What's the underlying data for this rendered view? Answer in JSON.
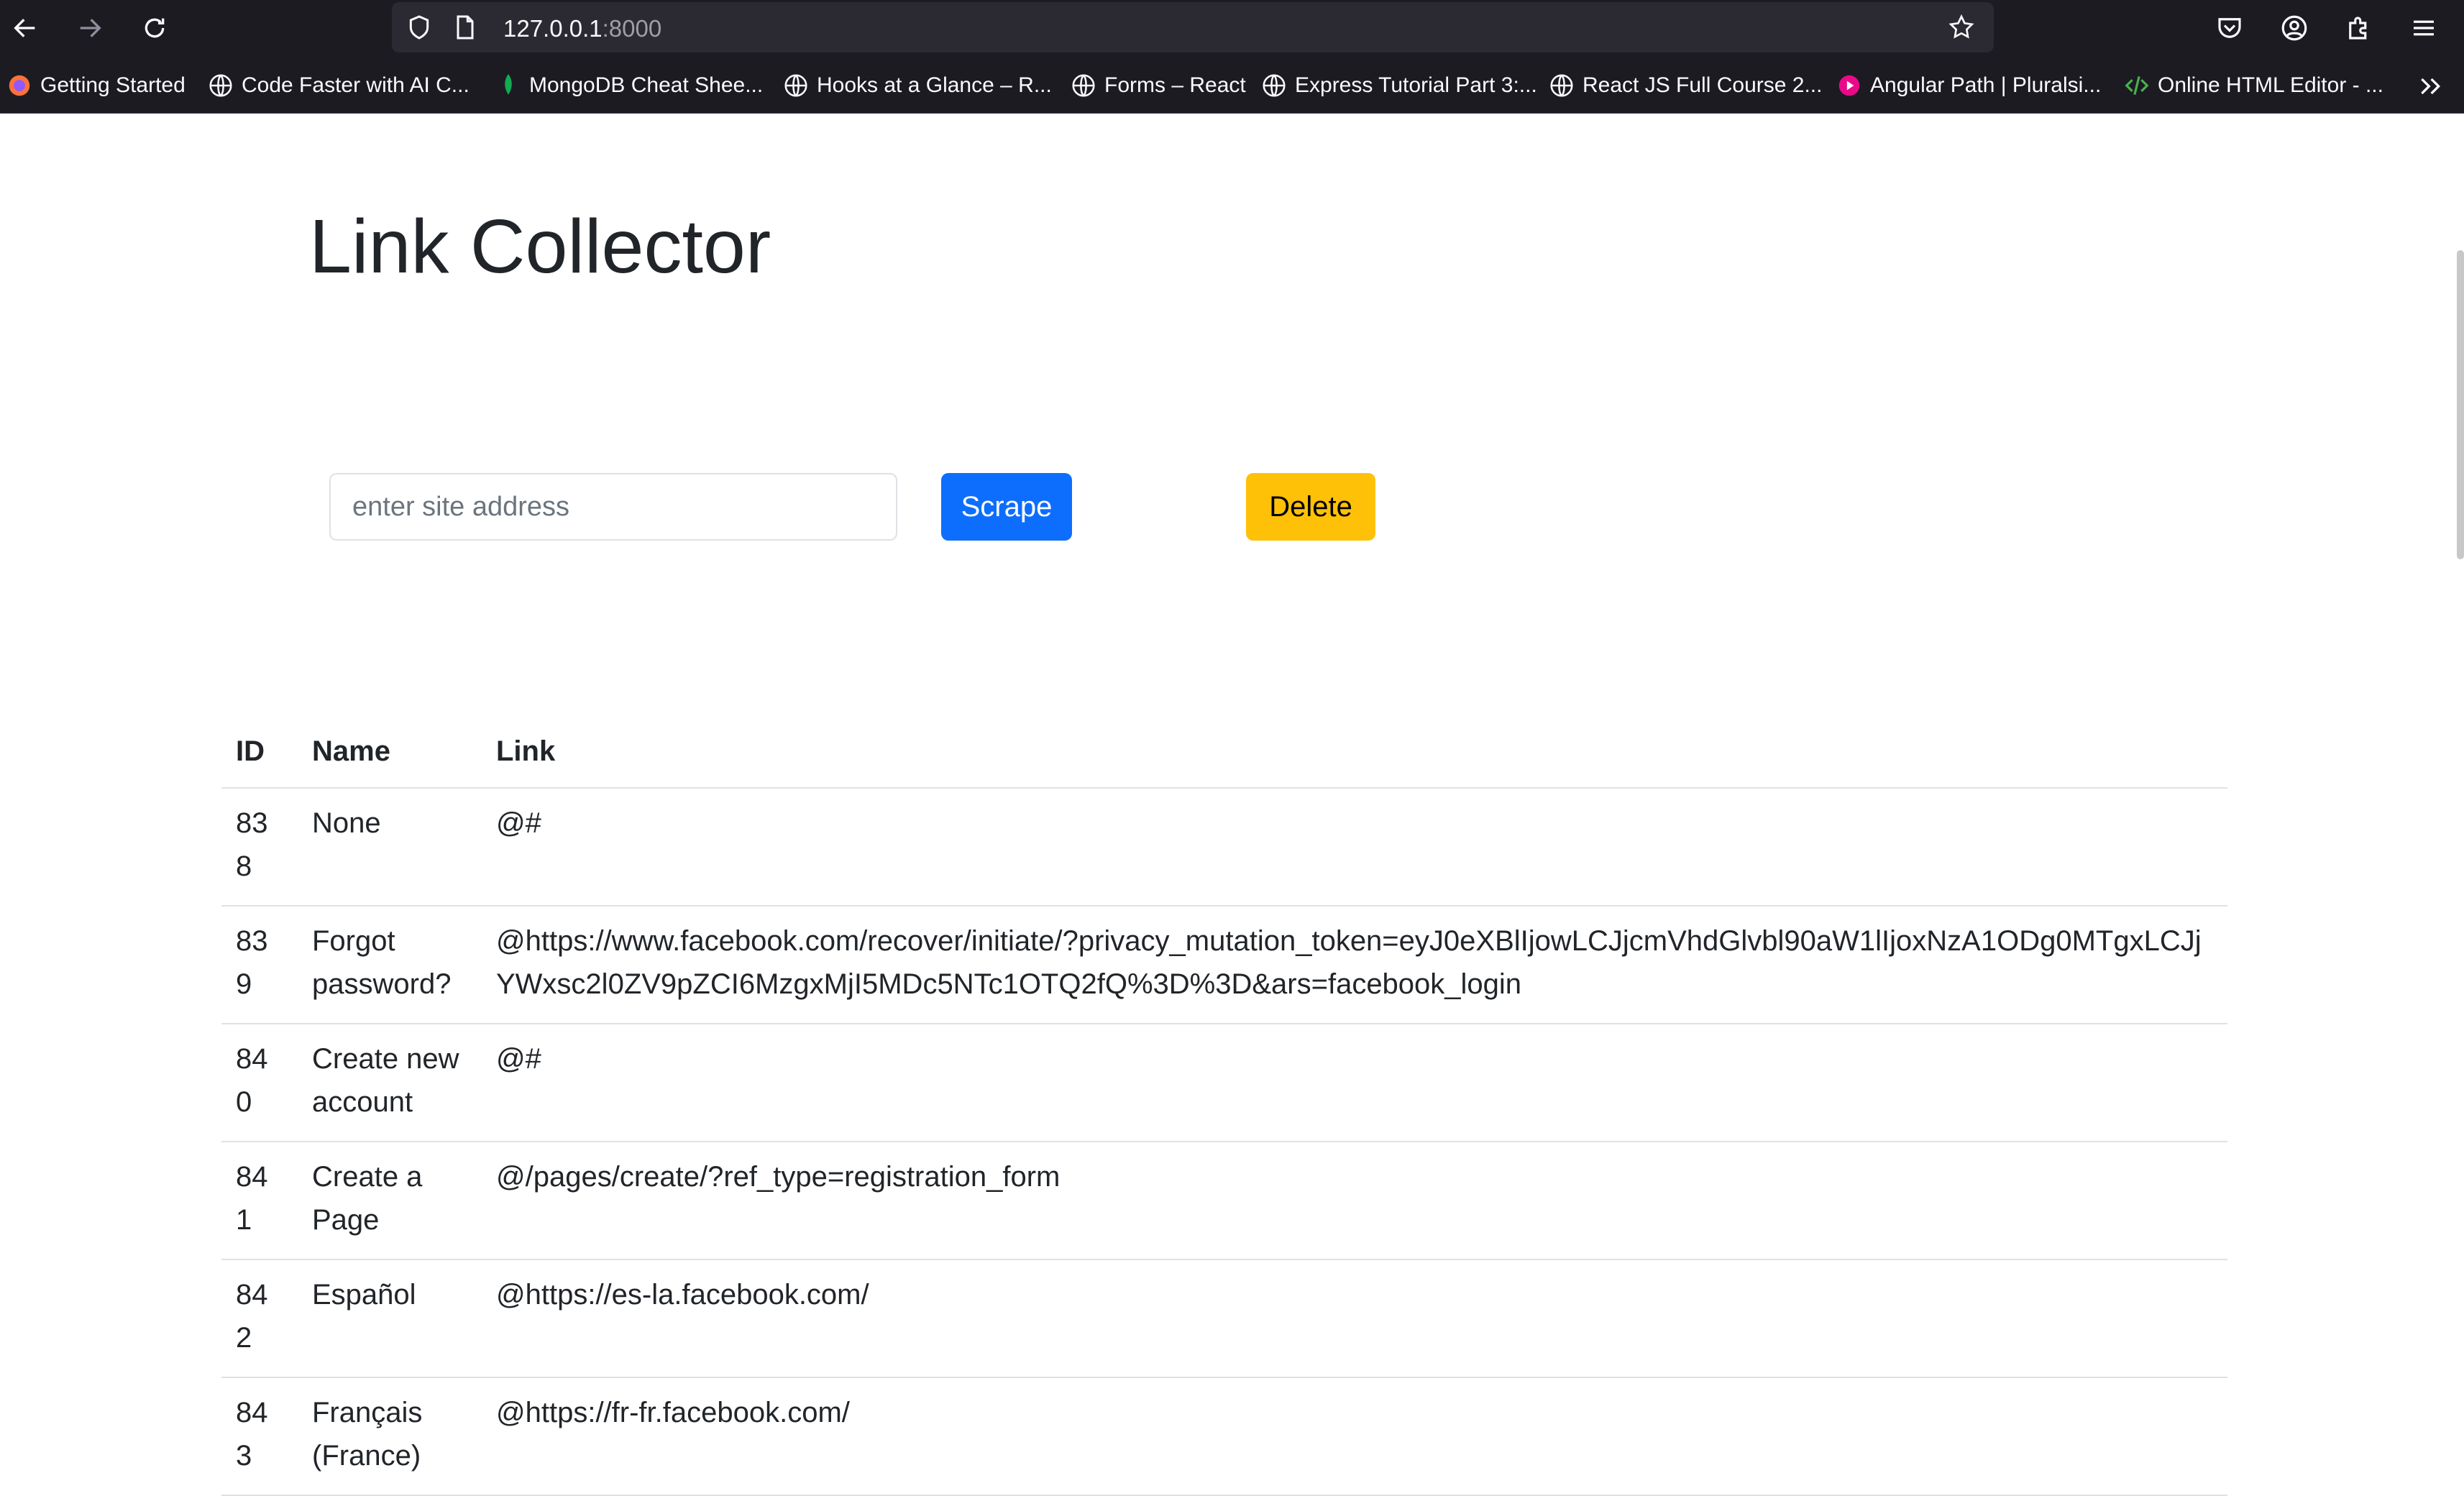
{
  "browser": {
    "url_host": "127.0.0.1",
    "url_port": ":8000",
    "bookmarks": [
      {
        "label": "Getting Started",
        "icon": "firefox-icon"
      },
      {
        "label": "Code Faster with AI C...",
        "icon": "globe-icon"
      },
      {
        "label": "MongoDB Cheat Shee...",
        "icon": "mongodb-leaf-icon"
      },
      {
        "label": "Hooks at a Glance – R...",
        "icon": "globe-icon"
      },
      {
        "label": "Forms – React",
        "icon": "globe-icon"
      },
      {
        "label": "Express Tutorial Part 3:...",
        "icon": "globe-icon"
      },
      {
        "label": "React JS Full Course 2...",
        "icon": "globe-icon"
      },
      {
        "label": "Angular Path | Pluralsi...",
        "icon": "pluralsight-icon"
      },
      {
        "label": "Online HTML Editor - ...",
        "icon": "code-icon"
      }
    ]
  },
  "page": {
    "title": "Link Collector",
    "input_placeholder": "enter site address",
    "scrape_label": "Scrape",
    "delete_label": "Delete",
    "colors": {
      "scrape": "#0d6efd",
      "delete": "#ffc107"
    }
  },
  "table": {
    "headers": {
      "id": "ID",
      "name": "Name",
      "link": "Link"
    },
    "rows": [
      {
        "id": "838",
        "name": "None",
        "link": "@#"
      },
      {
        "id": "839",
        "name": "Forgot password?",
        "link": "@https://www.facebook.com/recover/initiate/?privacy_mutation_token=eyJ0eXBlIjowLCJjcmVhdGlvbl90aW1lIjoxNzA1ODg0MTgxLCJjYWxsc2l0ZV9pZCI6MzgxMjI5MDc5NTc1OTQ2fQ%3D%3D&ars=facebook_login"
      },
      {
        "id": "840",
        "name": "Create new account",
        "link": "@#"
      },
      {
        "id": "841",
        "name": "Create a Page",
        "link": "@/pages/create/?ref_type=registration_form"
      },
      {
        "id": "842",
        "name": "Español",
        "link": "@https://es-la.facebook.com/"
      },
      {
        "id": "843",
        "name": "Français (France)",
        "link": "@https://fr-fr.facebook.com/"
      }
    ]
  }
}
